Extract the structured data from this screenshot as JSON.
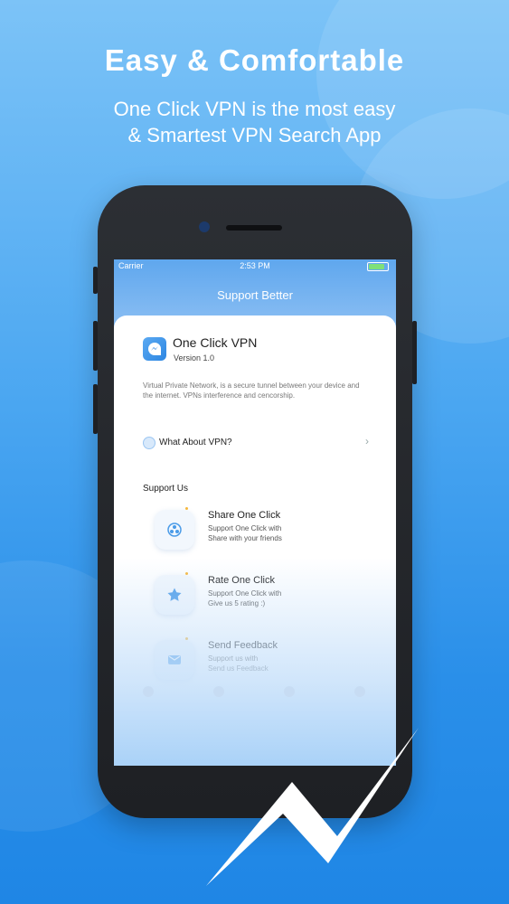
{
  "banner": {
    "headline": "Easy & Comfortable",
    "subline_1": "One Click VPN is the most easy",
    "subline_2": "& Smartest VPN Search App"
  },
  "status_bar": {
    "carrier": "Carrier",
    "time": "2:53 PM"
  },
  "nav": {
    "title": "Support Better"
  },
  "app_info": {
    "name": "One Click VPN",
    "version": "Version 1.0",
    "description": "Virtual Private Network, is a secure tunnel between your device and the internet. VPNs interference and cencorship."
  },
  "vpn_row": {
    "label": "What About VPN?"
  },
  "support": {
    "heading": "Support Us",
    "items": [
      {
        "title": "Share One Click",
        "line1": "Support One Click with",
        "line2": "Share with your friends",
        "icon": "share-icon"
      },
      {
        "title": "Rate One Click",
        "line1": "Support One Click with",
        "line2": "Give us 5 rating :)",
        "icon": "star-icon"
      },
      {
        "title": "Send Feedback",
        "line1": "Support us with",
        "line2": "Send us Feedback",
        "icon": "mail-icon"
      }
    ]
  },
  "colors": {
    "accent": "#2a8fe9",
    "dot": "#f6b73c"
  }
}
